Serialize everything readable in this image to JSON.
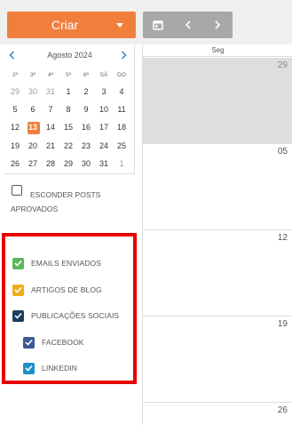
{
  "toolbar": {
    "create_label": "Criar",
    "create_color": "#f07f3c",
    "calendar_icon": "calendar-icon",
    "prev_icon": "chevron-left-icon",
    "next_icon": "chevron-right-icon"
  },
  "mini_calendar": {
    "title": "Agosto 2024",
    "weekdays": [
      "2ª",
      "3ª",
      "4ª",
      "5ª",
      "6ª",
      "SÁ",
      "DO"
    ],
    "today": "13",
    "weeks": [
      [
        "29",
        "30",
        "31",
        "1",
        "2",
        "3",
        "4"
      ],
      [
        "5",
        "6",
        "7",
        "8",
        "9",
        "10",
        "11"
      ],
      [
        "12",
        "13",
        "14",
        "15",
        "16",
        "17",
        "18"
      ],
      [
        "19",
        "20",
        "21",
        "22",
        "23",
        "24",
        "25"
      ],
      [
        "26",
        "27",
        "28",
        "29",
        "30",
        "31",
        "1"
      ]
    ]
  },
  "hide_posts": {
    "label": "ESCONDER POSTS APROVADOS",
    "checked": false
  },
  "filters": {
    "highlight_color": "#e80000",
    "items": [
      {
        "label": "EMAILS ENVIADOS",
        "color": "#5cb85c",
        "checked": true
      },
      {
        "label": "ARTIGOS DE BLOG",
        "color": "#f0ad1c",
        "checked": true
      },
      {
        "label": "PUBLICAÇÕES SOCIAIS",
        "color": "#1b3d5f",
        "checked": true
      },
      {
        "label": "FACEBOOK",
        "color": "#3b5998",
        "checked": true
      },
      {
        "label": "LINKEDIN",
        "color": "#1f8fc6",
        "checked": true
      }
    ]
  },
  "week_view": {
    "header": "Seg",
    "days": [
      "29",
      "05",
      "12",
      "19",
      "26"
    ]
  }
}
